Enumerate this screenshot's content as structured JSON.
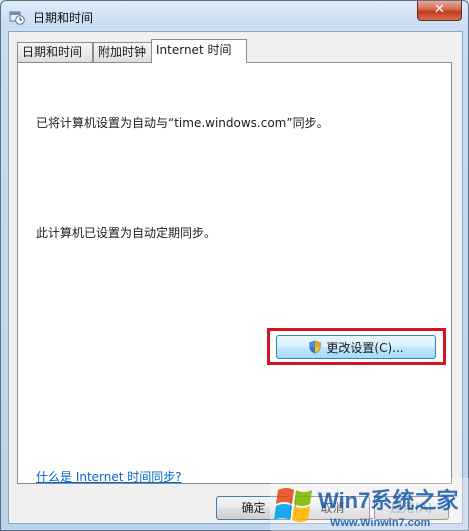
{
  "window": {
    "title": "日期和时间",
    "close_label": "✕"
  },
  "tabs": [
    {
      "label": "日期和时间"
    },
    {
      "label": "附加时钟"
    },
    {
      "label": "Internet 时间"
    }
  ],
  "panel": {
    "sync_text": "已将计算机设置为自动与“time.windows.com”同步。",
    "status_text": "此计算机已设置为自动定期同步。",
    "change_button_label": "更改设置(C)...",
    "help_link": "什么是 Internet 时间同步?"
  },
  "buttons": {
    "ok": "确定",
    "cancel": "取消",
    "apply": "应用(A)"
  },
  "watermark": {
    "brand": "Win7系统之家",
    "url": "Www.Winwin7.com"
  },
  "colors": {
    "highlight": "#d4161c",
    "link": "#0066cc"
  }
}
